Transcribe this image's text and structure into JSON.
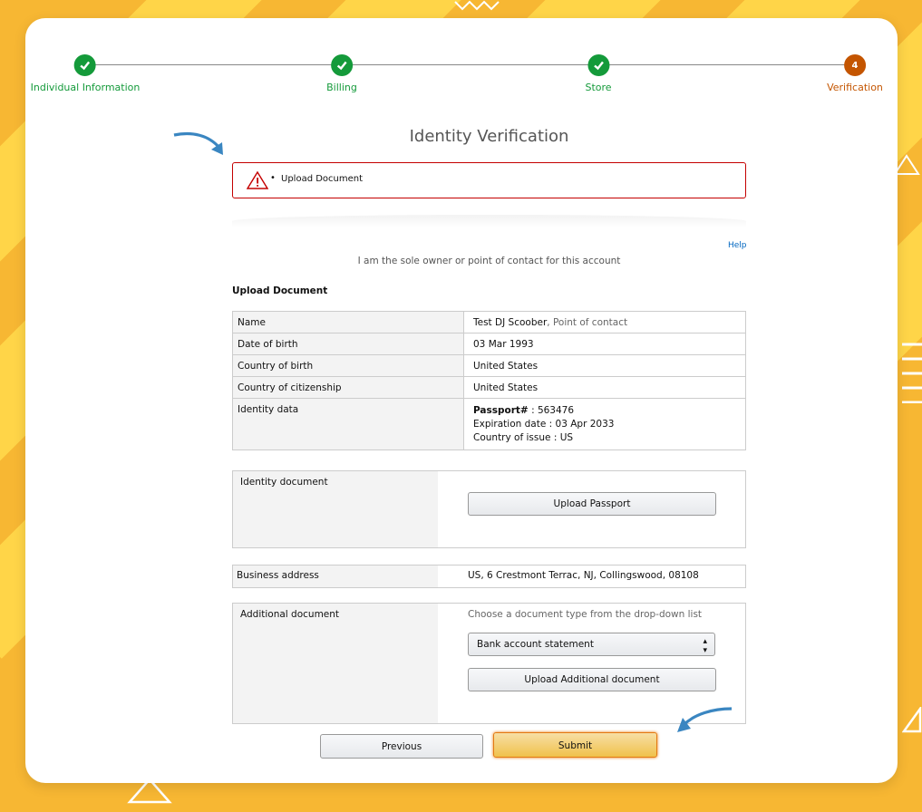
{
  "stepper": {
    "steps": [
      {
        "label": "Individual Information",
        "state": "done"
      },
      {
        "label": "Billing",
        "state": "done"
      },
      {
        "label": "Store",
        "state": "done"
      },
      {
        "label": "Verification",
        "state": "current",
        "number": "4"
      }
    ]
  },
  "page_title": "Identity Verification",
  "alert": {
    "item": "Upload Document"
  },
  "help_link": "Help",
  "sole_owner_text": "I am the sole owner or point of contact for this account",
  "section_title": "Upload Document",
  "info": {
    "name_label": "Name",
    "name_value": "Test DJ Scoober",
    "name_role": ", Point of contact",
    "dob_label": "Date of birth",
    "dob_value": "03 Mar 1993",
    "cob_label": "Country of birth",
    "cob_value": "United States",
    "coc_label": "Country of citizenship",
    "coc_value": "United States",
    "identity_label": "Identity data",
    "passport_label": "Passport#",
    "passport_value": " : 563476",
    "expiration": "Expiration date : 03 Apr 2033",
    "country_of_issue": "Country of issue : US"
  },
  "identity_document": {
    "label": "Identity document",
    "upload_button": "Upload Passport"
  },
  "business_address": {
    "label": "Business address",
    "value": "US, 6 Crestmont Terrac, NJ, Collingswood, 08108"
  },
  "additional_document": {
    "label": "Additional document",
    "hint": "Choose a document type from the drop-down list",
    "selected": "Bank account statement",
    "upload_button": "Upload Additional document"
  },
  "footer": {
    "previous": "Previous",
    "submit": "Submit"
  },
  "colors": {
    "done": "#149a3a",
    "current": "#c45500",
    "error": "#c40000",
    "submit": "#f0c14b",
    "background": "#f7b733"
  }
}
